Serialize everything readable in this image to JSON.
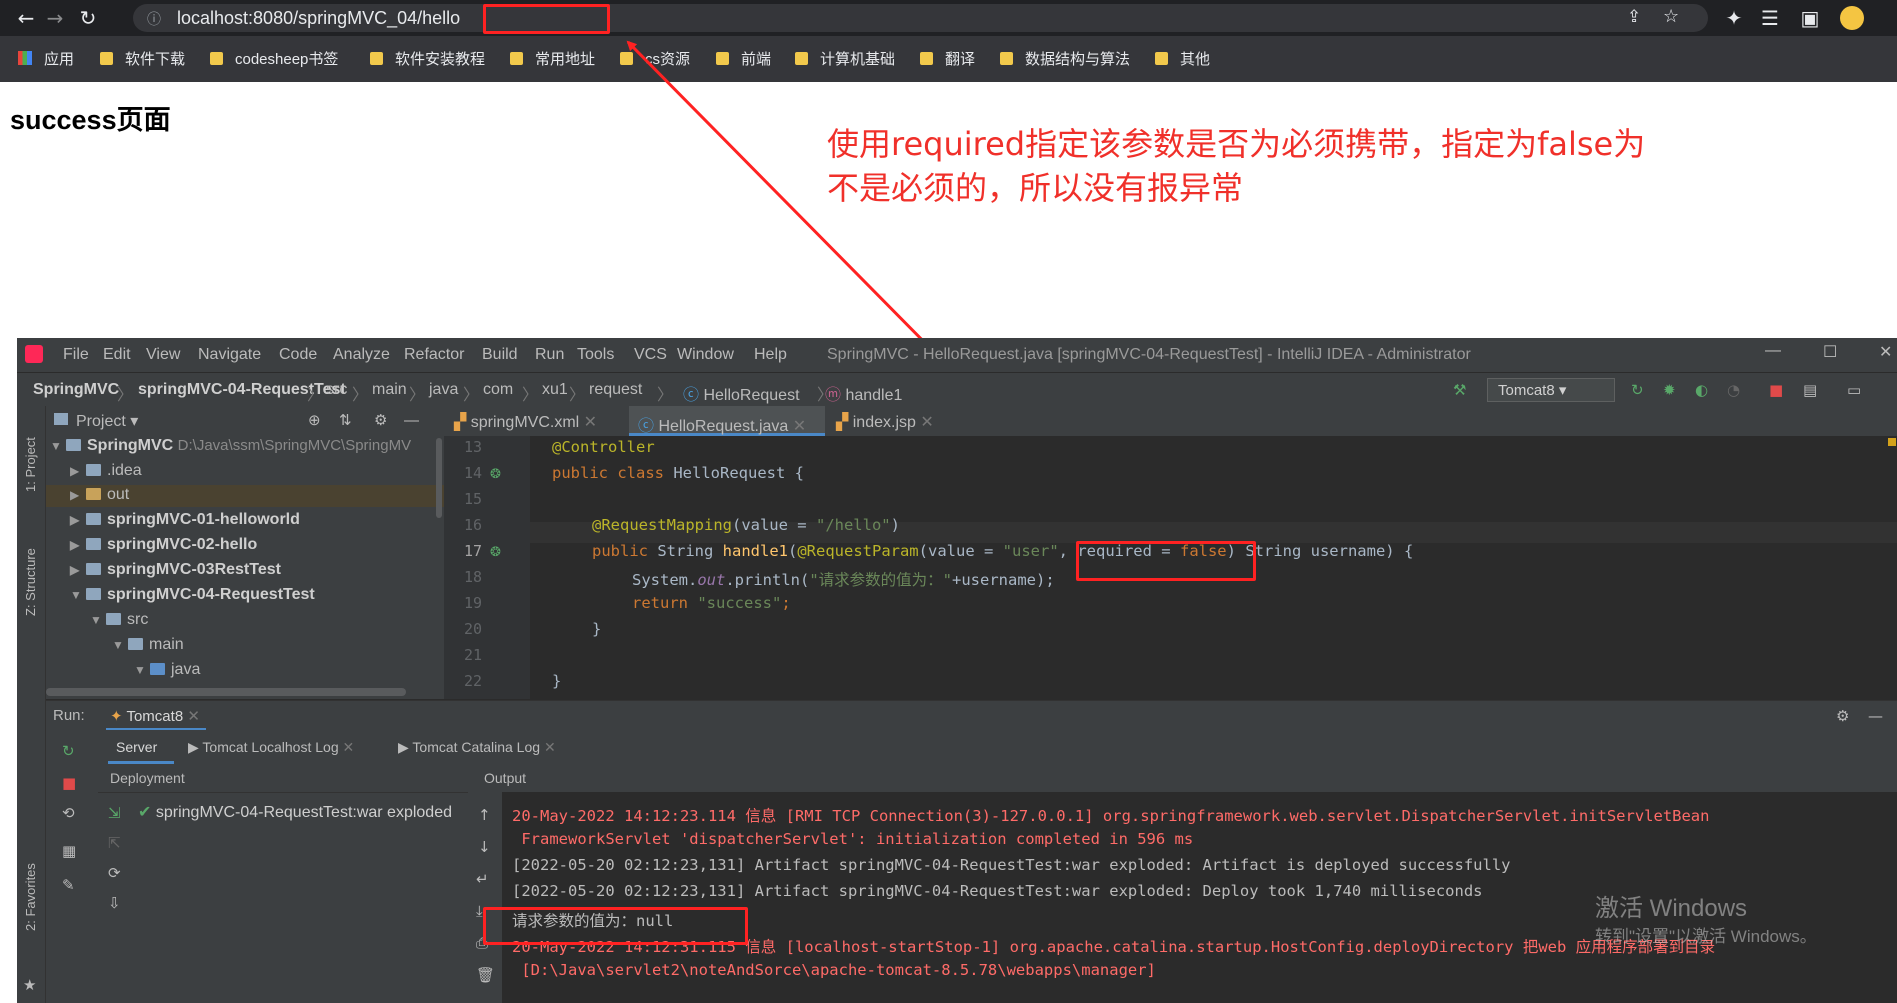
{
  "browser": {
    "url": "localhost:8080/springMVC_04/hello",
    "bookmarks": [
      "应用",
      "软件下载",
      "codesheep书签",
      "软件安装教程",
      "常用地址",
      "cs资源",
      "前端",
      "计算机基础",
      "翻译",
      "数据结构与算法",
      "其他"
    ]
  },
  "page": {
    "heading": "success页面",
    "annotation_line1": "使用required指定该参数是否为必须携带，指定为false为",
    "annotation_line2": "不是必须的，所以没有报异常"
  },
  "ide": {
    "menu": [
      "File",
      "Edit",
      "View",
      "Navigate",
      "Code",
      "Analyze",
      "Refactor",
      "Build",
      "Run",
      "Tools",
      "VCS",
      "Window",
      "Help"
    ],
    "title": "SpringMVC - HelloRequest.java [springMVC-04-RequestTest] - IntelliJ IDEA - Administrator",
    "breadcrumbs": [
      "SpringMVC",
      "springMVC-04-RequestTest",
      "src",
      "main",
      "java",
      "com",
      "xu1",
      "request",
      "HelloRequest",
      "handle1"
    ],
    "run_config": "Tomcat8",
    "project_label": "Project",
    "project_root": "SpringMVC",
    "project_root_path": "D:\\Java\\ssm\\SpringMVC\\SpringMV",
    "tree": [
      ".idea",
      "out",
      "springMVC-01-helloworld",
      "springMVC-02-hello",
      "springMVC-03RestTest",
      "springMVC-04-RequestTest",
      "src",
      "main",
      "java"
    ],
    "editor_tabs": [
      "springMVC.xml",
      "HelloRequest.java",
      "index.jsp"
    ],
    "line_numbers": [
      "13",
      "14",
      "15",
      "16",
      "17",
      "18",
      "19",
      "20",
      "21",
      "22"
    ],
    "code": {
      "l13": "@Controller",
      "l14a": "public class ",
      "l14b": "HelloRequest {",
      "l16a": "@RequestMapping",
      "l16b": "(value = ",
      "l16c": "\"/hello\"",
      "l16d": ")",
      "l17a": "public ",
      "l17b": "String ",
      "l17c": "handle1",
      "l17d": "(",
      "l17e": "@RequestParam",
      "l17f": "(value = ",
      "l17g": "\"user\"",
      "l17h": ", required = ",
      "l17i": "false",
      "l17j": ") String username) {",
      "l18a": "System.",
      "l18b": "out",
      "l18c": ".println(",
      "l18d": "\"请求参数的值为：\"",
      "l18e": "+username);",
      "l19a": "return ",
      "l19b": "\"success\"",
      "l19c": ";",
      "l20": "}",
      "l22": "}"
    },
    "vertical_tabs": [
      "1: Project",
      "Z: Structure",
      "2: Favorites"
    ],
    "run_label": "Run:",
    "run_tab": "Tomcat8",
    "server_tabs": [
      "Server",
      "Tomcat Localhost Log",
      "Tomcat Catalina Log"
    ],
    "deployment_label": "Deployment",
    "output_label": "Output",
    "deployment_item": "springMVC-04-RequestTest:war exploded",
    "output_lines": [
      "20-May-2022 14:12:23.114 信息 [RMI TCP Connection(3)-127.0.0.1] org.springframework.web.servlet.DispatcherServlet.initServletBean",
      " FrameworkServlet 'dispatcherServlet': initialization completed in 596 ms",
      "[2022-05-20 02:12:23,131] Artifact springMVC-04-RequestTest:war exploded: Artifact is deployed successfully",
      "[2022-05-20 02:12:23,131] Artifact springMVC-04-RequestTest:war exploded: Deploy took 1,740 milliseconds",
      "请求参数的值为：null",
      "20-May-2022 14:12:31.115 信息 [localhost-startStop-1] org.apache.catalina.startup.HostConfig.deployDirectory 把web 应用程序部署到目录",
      " [D:\\Java\\servlet2\\noteAndSorce\\apache-tomcat-8.5.78\\webapps\\manager]"
    ]
  },
  "watermark": {
    "line1": "激活 Windows",
    "line2": "转到\"设置\"以激活 Windows。"
  },
  "colors": {
    "annotation_red": "#f0302a",
    "ide_bg": "#2b2b2b",
    "keyword": "#cc7832",
    "string": "#6a8759",
    "log_red": "#ff6b68"
  }
}
